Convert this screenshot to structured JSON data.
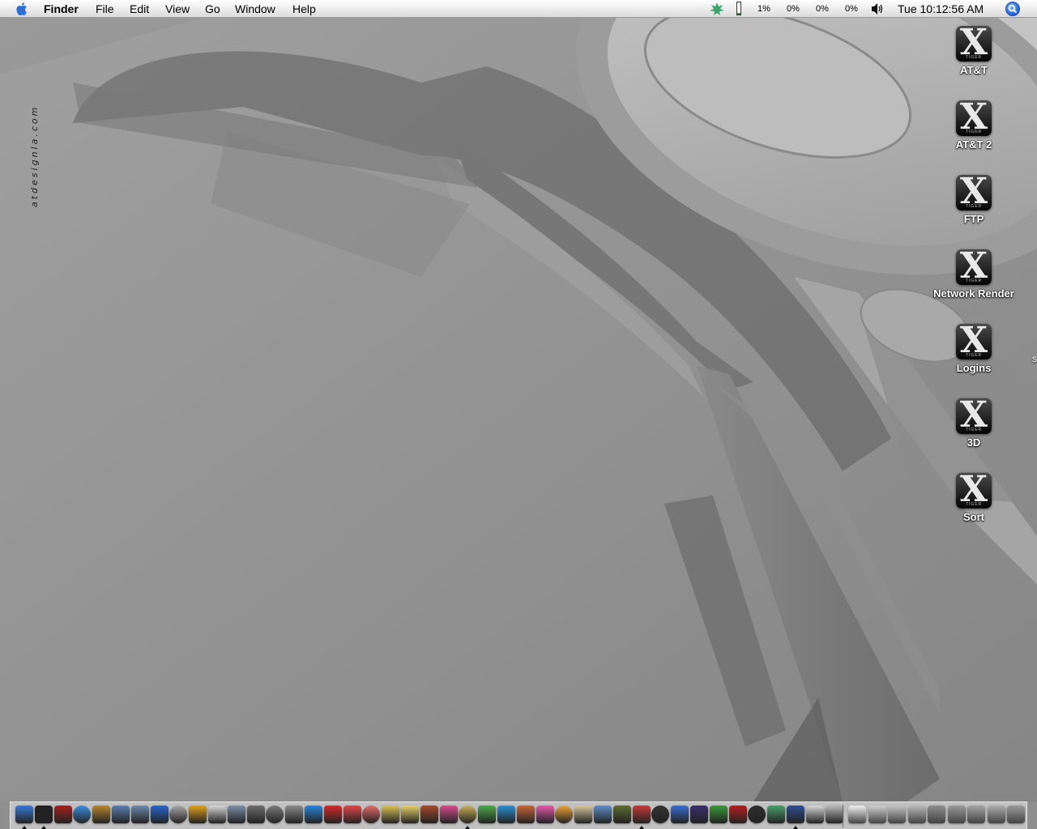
{
  "menubar": {
    "app_name": "Finder",
    "menus": [
      "File",
      "Edit",
      "View",
      "Go",
      "Window",
      "Help"
    ],
    "status": {
      "cpu1": "1%",
      "cpu2": "0%",
      "cpu3": "0%",
      "cpu4": "0%"
    },
    "clock": "Tue 10:12:56 AM"
  },
  "desktop": {
    "watermark": "atdesignla.com",
    "icon_badge": "X",
    "icon_badge_sub": "TIGER",
    "icons": [
      {
        "label": "AT&T"
      },
      {
        "label": "AT&T 2"
      },
      {
        "label": "FTP"
      },
      {
        "label": "Network Render"
      },
      {
        "label": "Logins"
      },
      {
        "label": "3D"
      },
      {
        "label": "Sort"
      }
    ],
    "offscreen_label_fragment": "s"
  },
  "dock": {
    "apps": [
      {
        "name": "Finder",
        "color": "#3b79d6",
        "running": true
      },
      {
        "name": "DVD Player",
        "color": "#222222",
        "running": true
      },
      {
        "name": "Dictionary",
        "color": "#a3221e",
        "running": false
      },
      {
        "name": "Safari",
        "color": "#3d8fe0",
        "running": false
      },
      {
        "name": "Address Book",
        "color": "#b8862f",
        "running": false
      },
      {
        "name": "Preview",
        "color": "#5a7fb0",
        "running": false
      },
      {
        "name": "Network Utility",
        "color": "#6c8aad",
        "running": false
      },
      {
        "name": "Internet Explorer",
        "color": "#2a66c9",
        "running": false
      },
      {
        "name": "Calculator",
        "color": "#a8a8a8",
        "running": false
      },
      {
        "name": "Money",
        "color": "#e0a21f",
        "running": false
      },
      {
        "name": "TextEdit",
        "color": "#d7d7d7",
        "running": false
      },
      {
        "name": "Image Capture",
        "color": "#7c8fa6",
        "running": false
      },
      {
        "name": "Utility A",
        "color": "#6d6d6d",
        "running": false
      },
      {
        "name": "Utility B",
        "color": "#7b7b7b",
        "running": false
      },
      {
        "name": "Utility C",
        "color": "#8a8a8a",
        "running": false
      },
      {
        "name": "QuickTime",
        "color": "#2c84d8",
        "running": false
      },
      {
        "name": "Acrobat",
        "color": "#d52b2b",
        "running": false
      },
      {
        "name": "Acrobat Reader",
        "color": "#e04848",
        "running": false
      },
      {
        "name": "Acrobat Distiller",
        "color": "#e86a6a",
        "running": false
      },
      {
        "name": "Photo App",
        "color": "#d9c35a",
        "running": false
      },
      {
        "name": "Sun App",
        "color": "#e8d26a",
        "running": false
      },
      {
        "name": "FTP Client",
        "color": "#a54a2a",
        "running": false
      },
      {
        "name": "Butterfly",
        "color": "#d94d8e",
        "running": false
      },
      {
        "name": "Eye App",
        "color": "#c9b15a",
        "running": true
      },
      {
        "name": "Pencil",
        "color": "#4ea84a",
        "running": false
      },
      {
        "name": "Wave App",
        "color": "#2f8fd1",
        "running": false
      },
      {
        "name": "Portrait",
        "color": "#c6663b",
        "running": false
      },
      {
        "name": "Flower A",
        "color": "#e35aa8",
        "running": false
      },
      {
        "name": "Flower B",
        "color": "#f0a33a",
        "running": false
      },
      {
        "name": "Script Editor",
        "color": "#d9c8a0",
        "running": false
      },
      {
        "name": "Puzzle",
        "color": "#5d8fc7",
        "running": false
      },
      {
        "name": "Map Tool",
        "color": "#5e6b2c",
        "running": false
      },
      {
        "name": "Target",
        "color": "#c53b3b",
        "running": true
      },
      {
        "name": "Clapboard",
        "color": "#333333",
        "running": false
      },
      {
        "name": "Shapes",
        "color": "#3b6fd1",
        "running": false
      },
      {
        "name": "Lantern",
        "color": "#3a2f6e",
        "running": false
      },
      {
        "name": "Dreamweaver",
        "color": "#3c9a3c",
        "running": false
      },
      {
        "name": "Flash",
        "color": "#b51e1e",
        "running": false
      },
      {
        "name": "Flash Player",
        "color": "#2e2e2e",
        "running": false
      },
      {
        "name": "iTunes",
        "color": "#4c9f6a",
        "running": false
      },
      {
        "name": "Word",
        "color": "#2f4f8f",
        "running": true
      },
      {
        "name": "Eraser",
        "color": "#d8d8d8",
        "running": false
      },
      {
        "name": "iPhoto",
        "color": "#b8b8b8",
        "running": false
      }
    ],
    "docs": [
      {
        "name": "Document",
        "color": "#f0f0f0"
      },
      {
        "name": "Doc Stack A",
        "color": "#cfcfcf"
      },
      {
        "name": "Doc Stack B",
        "color": "#c4c4c4"
      },
      {
        "name": "Doc Stack C",
        "color": "#b9b9b9"
      },
      {
        "name": "Window A",
        "color": "#8d8d8d"
      },
      {
        "name": "Window B",
        "color": "#999999"
      },
      {
        "name": "Window C",
        "color": "#a3a3a3"
      },
      {
        "name": "Window D",
        "color": "#adadad"
      },
      {
        "name": "Trash",
        "color": "#9a9a9a"
      }
    ]
  }
}
